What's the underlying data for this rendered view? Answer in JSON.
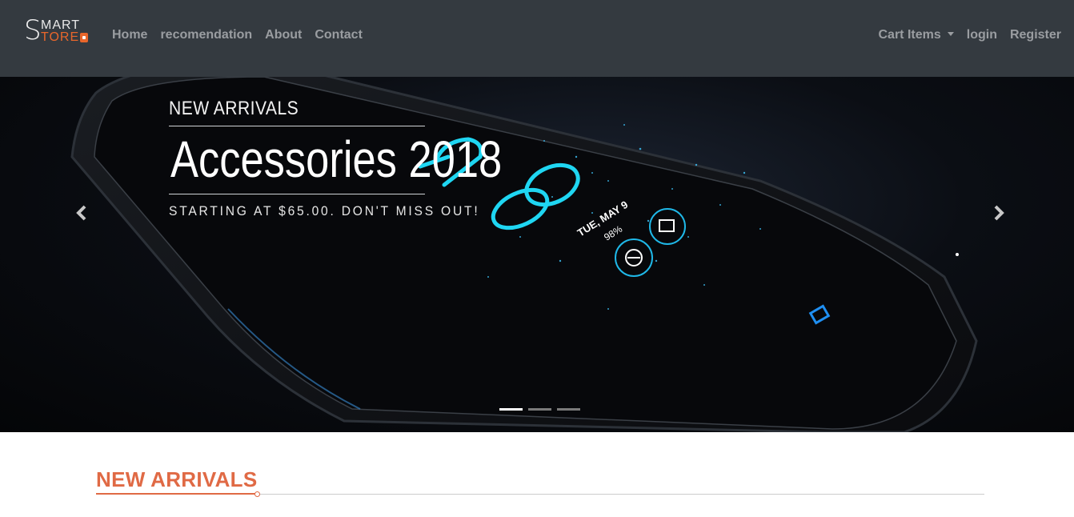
{
  "brand": {
    "logo_initial": "S",
    "logo_top": "MART",
    "logo_bottom": "TORE"
  },
  "nav": {
    "left": [
      "Home",
      "recomendation",
      "About",
      "Contact"
    ],
    "cart_label": "Cart Items",
    "login_label": "login",
    "register_label": "Register"
  },
  "carousel": {
    "caption_small": "NEW ARRIVALS",
    "caption_large": "Accessories 2018",
    "caption_sub": "STARTING AT $65.00. DON'T MISS OUT!",
    "phone_date": "TUE, MAY 9",
    "phone_battery": "98%",
    "prev_icon": "chevron-left-icon",
    "next_icon": "chevron-right-icon",
    "slide_count": 3,
    "active_slide": 1
  },
  "section": {
    "title": "NEW ARRIVALS"
  },
  "colors": {
    "navbar": "#343a40",
    "accent": "#e06a45",
    "glow": "#1fd6f2"
  }
}
